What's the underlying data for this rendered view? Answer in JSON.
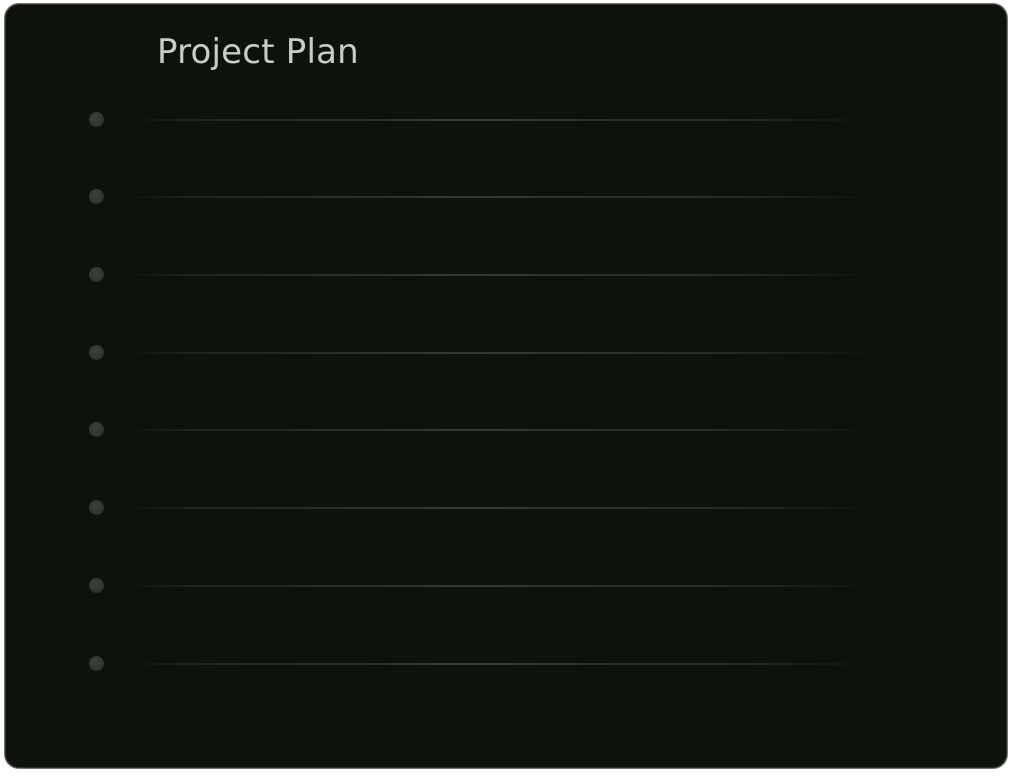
{
  "card": {
    "title": "Project Plan"
  },
  "items": [
    {
      "kind": "placeholder-row"
    },
    {
      "kind": "placeholder-row"
    },
    {
      "kind": "placeholder-row"
    },
    {
      "kind": "placeholder-row"
    },
    {
      "kind": "placeholder-row"
    },
    {
      "kind": "placeholder-row"
    },
    {
      "kind": "placeholder-row"
    },
    {
      "kind": "placeholder-row"
    }
  ],
  "colors": {
    "background": "#0d130c",
    "border": "#2b3324",
    "title": "#c9cdc6",
    "bullet": "#343a30",
    "line": "#343d2f"
  }
}
